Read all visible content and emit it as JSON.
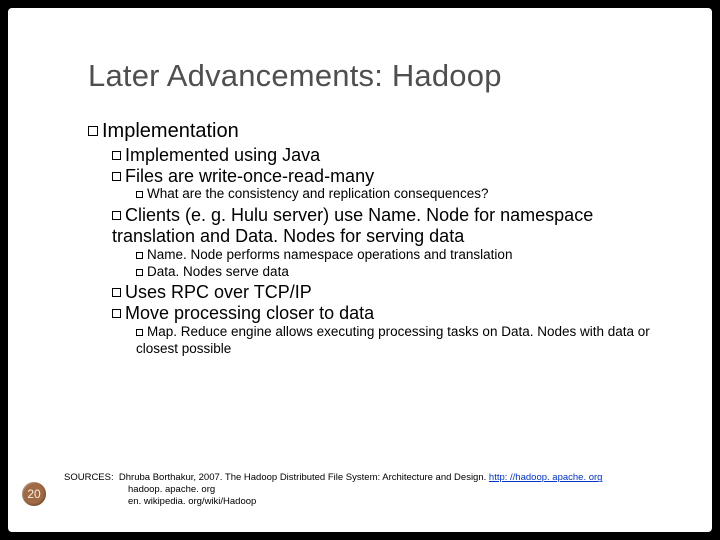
{
  "title": "Later Advancements: Hadoop",
  "b": {
    "l1_a": "Implementation",
    "l2_a": "Implemented using Java",
    "l2_b": "Files are write-once-read-many",
    "l3_a": "What are the consistency and replication consequences?",
    "l2_c": "Clients (e. g. Hulu server) use Name. Node for namespace translation and Data. Nodes for serving data",
    "l3_b": "Name. Node performs namespace operations and translation",
    "l3_c": "Data. Nodes serve data",
    "l2_d": "Uses RPC over TCP/IP",
    "l2_e": "Move processing closer to data",
    "l3_d": "Map. Reduce engine allows executing processing tasks on Data. Nodes with data or closest possible"
  },
  "sources": {
    "label": "SOURCES:",
    "line1a": "Dhruba Borthakur, 2007. The Hadoop Distributed File System: Architecture and Design. ",
    "link": "http: //hadoop. apache. org",
    "line2": "hadoop. apache. org",
    "line3": "en. wikipedia. org/wiki/Hadoop"
  },
  "page": "20"
}
